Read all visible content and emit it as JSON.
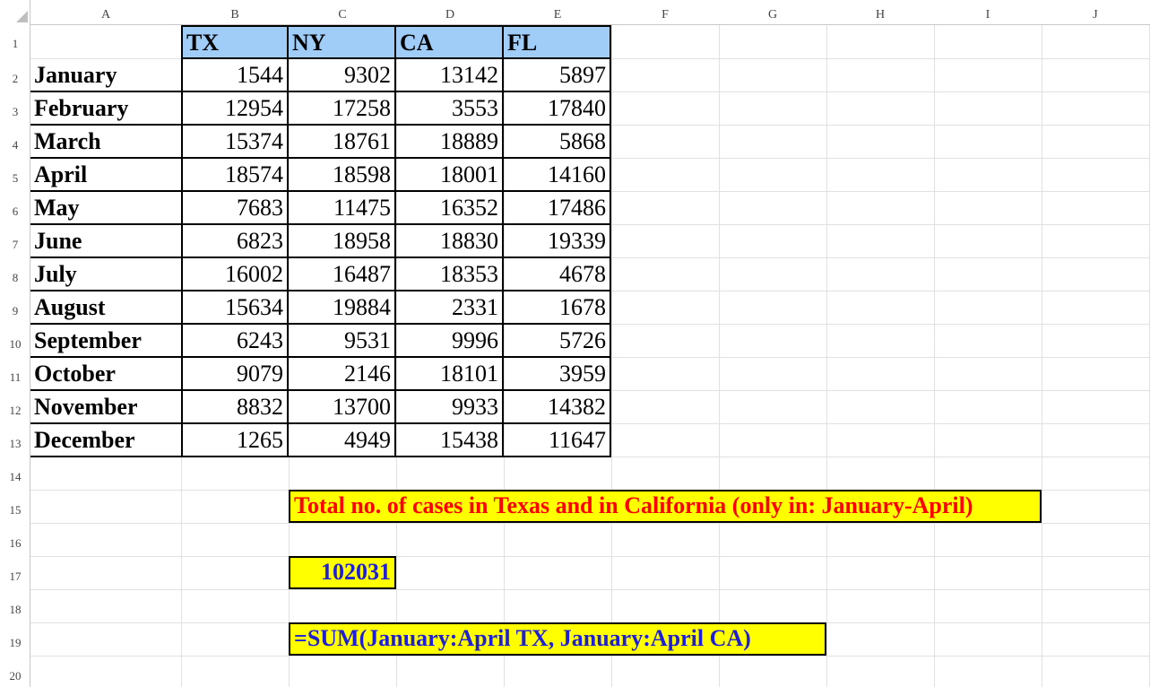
{
  "columns": [
    "A",
    "B",
    "C",
    "D",
    "E",
    "F",
    "G",
    "H",
    "I",
    "J"
  ],
  "rows": [
    "1",
    "2",
    "3",
    "4",
    "5",
    "6",
    "7",
    "8",
    "9",
    "10",
    "11",
    "12",
    "13",
    "14",
    "15",
    "16",
    "17",
    "18",
    "19",
    "20"
  ],
  "table": {
    "headers": [
      "TX",
      "NY",
      "CA",
      "FL"
    ],
    "months": [
      "January",
      "February",
      "March",
      "April",
      "May",
      "June",
      "July",
      "August",
      "September",
      "October",
      "November",
      "December"
    ],
    "values": [
      [
        "1544",
        "9302",
        "13142",
        "5897"
      ],
      [
        "12954",
        "17258",
        "3553",
        "17840"
      ],
      [
        "15374",
        "18761",
        "18889",
        "5868"
      ],
      [
        "18574",
        "18598",
        "18001",
        "14160"
      ],
      [
        "7683",
        "11475",
        "16352",
        "17486"
      ],
      [
        "6823",
        "18958",
        "18830",
        "19339"
      ],
      [
        "16002",
        "16487",
        "18353",
        "4678"
      ],
      [
        "15634",
        "19884",
        "2331",
        "1678"
      ],
      [
        "6243",
        "9531",
        "9996",
        "5726"
      ],
      [
        "9079",
        "2146",
        "18101",
        "3959"
      ],
      [
        "8832",
        "13700",
        "9933",
        "14382"
      ],
      [
        "1265",
        "4949",
        "15438",
        "11647"
      ]
    ]
  },
  "annotations": {
    "title": "Total no. of cases in Texas and in California (only in: January-April)",
    "result": "102031",
    "formula": "=SUM(January:April TX, January:April CA)"
  },
  "colors": {
    "header_fill": "#9fcdf7",
    "highlight_fill": "#ffff00",
    "title_text": "#ff0000",
    "result_text": "#1f1fd6",
    "gridline": "#e1e1e1"
  }
}
